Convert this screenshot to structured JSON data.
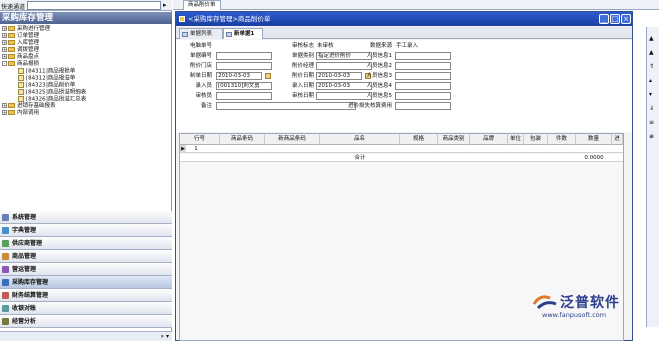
{
  "quick": {
    "label": "快速通道"
  },
  "left_panel": {
    "title": "采购库存管理"
  },
  "tree": [
    {
      "label": "采购进行管理",
      "kind": "folder"
    },
    {
      "label": "订单管理",
      "kind": "folder"
    },
    {
      "label": "入库管理",
      "kind": "folder"
    },
    {
      "label": "调拨管理",
      "kind": "folder"
    },
    {
      "label": "商品盘点",
      "kind": "folder"
    },
    {
      "label": "商品报损",
      "kind": "folder-open"
    },
    {
      "label": "[84311]商品报损单",
      "kind": "doc"
    },
    {
      "label": "[84312]商品报溢单",
      "kind": "doc"
    },
    {
      "label": "[84323]商品削价单",
      "kind": "doc"
    },
    {
      "label": "[84325]商品损溢明细表",
      "kind": "doc"
    },
    {
      "label": "[84326]商品损溢汇总表",
      "kind": "doc"
    },
    {
      "label": "进销存基础报表",
      "kind": "folder"
    },
    {
      "label": "内部调用",
      "kind": "folder"
    }
  ],
  "modules": [
    {
      "label": "系统管理",
      "color": "#6a7fb8"
    },
    {
      "label": "字典管理",
      "color": "#4a8fc9"
    },
    {
      "label": "供应商管理",
      "color": "#5aa05a"
    },
    {
      "label": "商品管理",
      "color": "#c98a3a"
    },
    {
      "label": "营运管理",
      "color": "#8a5ab0"
    },
    {
      "label": "采购库存管理",
      "color": "#3a6ec0"
    },
    {
      "label": "财务结算管理",
      "color": "#c05a5a"
    },
    {
      "label": "收银对账",
      "color": "#5a9aa0"
    },
    {
      "label": "经营分析",
      "color": "#7a7a3a"
    }
  ],
  "top_tab": "商品削价单",
  "window": {
    "title": "<采购库存管理>商品削价单"
  },
  "subtabs": [
    "单据列表",
    "新单据1"
  ],
  "form": {
    "labels": {
      "c1": [
        "电脑单号",
        "单据编号",
        "削价门店",
        "制单日期",
        "录入员",
        "审核员",
        "备注"
      ],
      "c2": [
        "审核标志",
        "单据类别",
        "削价经理",
        "削价日期",
        "录入日期",
        "审核日期"
      ],
      "c3": [
        "数据来源",
        "人员信息1",
        "人员信息2",
        "人员信息3",
        "人员信息4",
        "人员信息5",
        "进价损失核算费用"
      ]
    },
    "values": {
      "audit_flag": "未审核",
      "doc_type": "指定进价削价",
      "make_date": "2010-03-03",
      "entry_user": "[001310]刘文勇",
      "discount_date": "2010-03-03",
      "entry_date": "2010-03-03",
      "source": "手工录入"
    }
  },
  "grid": {
    "headers": [
      "行号",
      "商品条码",
      "新商品条码",
      "品名",
      "规格",
      "商品类别",
      "品牌",
      "单位",
      "包装",
      "件数",
      "数量",
      "进价"
    ],
    "rows": [
      {
        "no": "1"
      }
    ],
    "total_label": "合计",
    "total_qty": "0.0000"
  },
  "logo": {
    "name": "泛普软件",
    "url": "www.fanpusoft.com"
  }
}
